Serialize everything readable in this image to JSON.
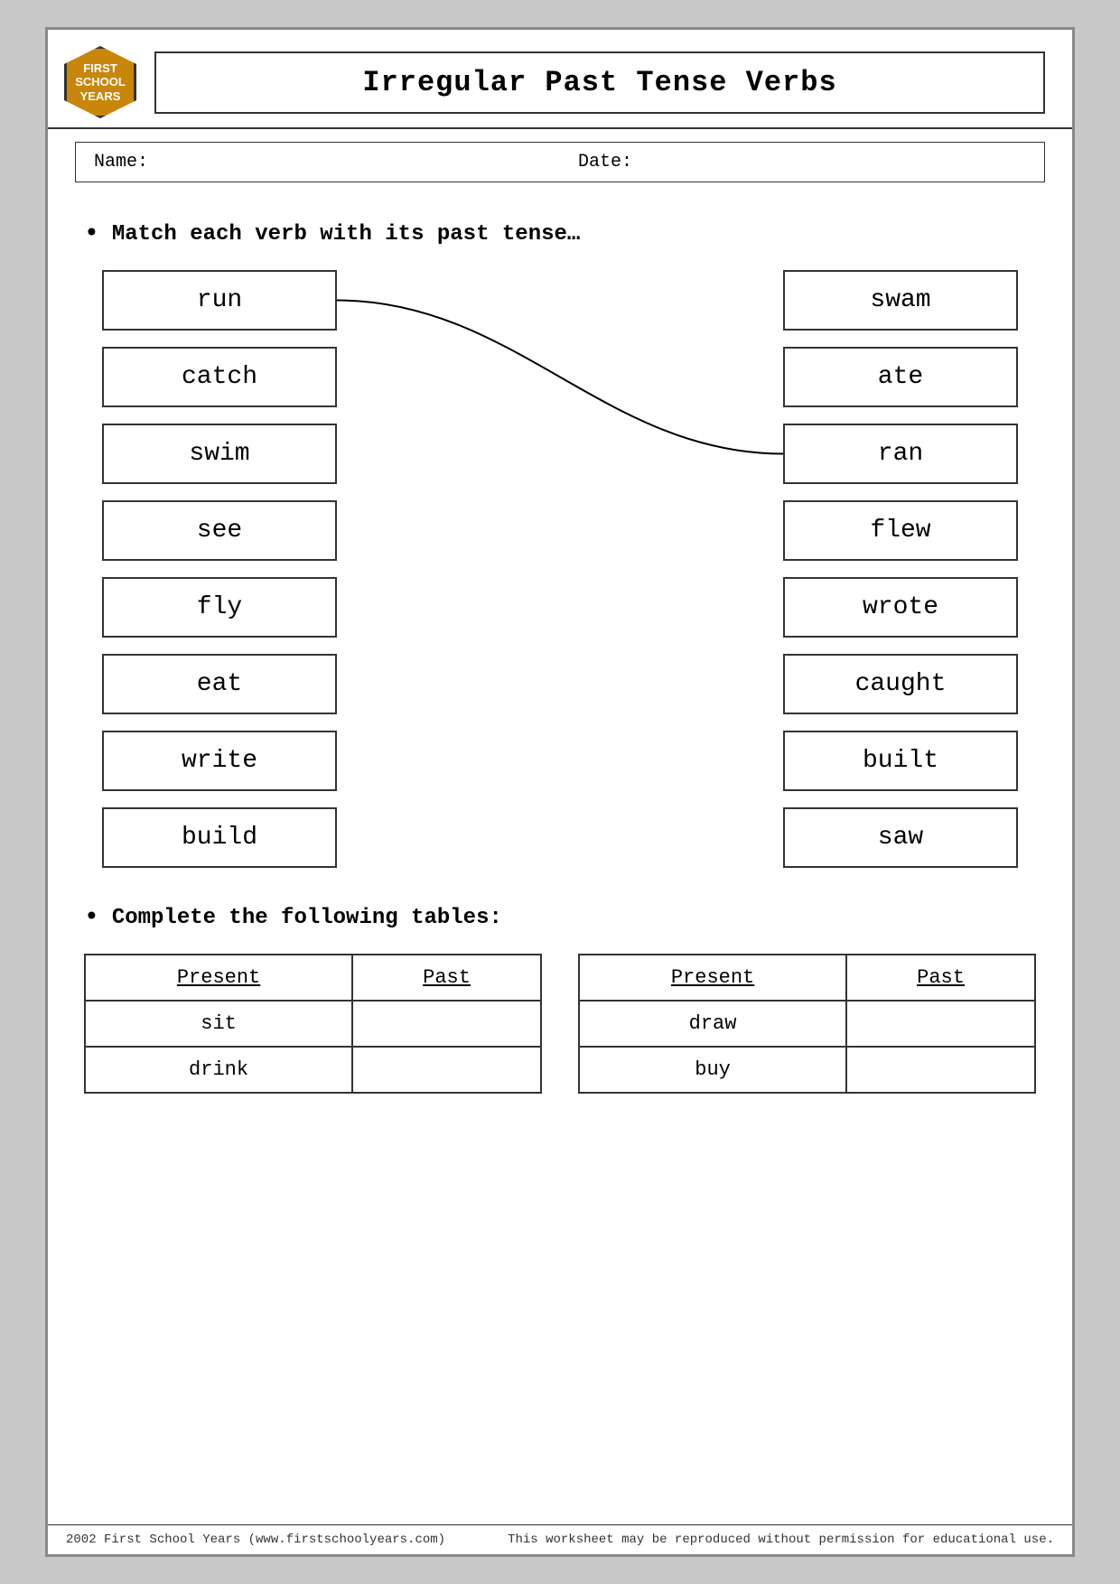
{
  "header": {
    "logo_line1": "FIRST",
    "logo_line2": "SCHOOL",
    "logo_line3": "YEARS",
    "title": "Irregular Past Tense Verbs"
  },
  "fields": {
    "name_label": "Name:",
    "date_label": "Date:"
  },
  "instruction1": "Match each verb with its past tense…",
  "left_verbs": [
    {
      "word": "run"
    },
    {
      "word": "catch"
    },
    {
      "word": "swim"
    },
    {
      "word": "see"
    },
    {
      "word": "fly"
    },
    {
      "word": "eat"
    },
    {
      "word": "write"
    },
    {
      "word": "build"
    }
  ],
  "right_verbs": [
    {
      "word": "swam"
    },
    {
      "word": "ate"
    },
    {
      "word": "ran"
    },
    {
      "word": "flew"
    },
    {
      "word": "wrote"
    },
    {
      "word": "caught"
    },
    {
      "word": "built"
    },
    {
      "word": "saw"
    }
  ],
  "instruction2": "Complete the following tables:",
  "table1": {
    "col1": "Present",
    "col2": "Past",
    "rows": [
      {
        "present": "sit",
        "past": ""
      },
      {
        "present": "drink",
        "past": ""
      }
    ]
  },
  "table2": {
    "col1": "Present",
    "col2": "Past",
    "rows": [
      {
        "present": "draw",
        "past": ""
      },
      {
        "present": "buy",
        "past": ""
      }
    ]
  },
  "footer": {
    "left": "2002 First School Years  (www.firstschoolyears.com)",
    "right": "This worksheet may be reproduced without permission for educational use."
  }
}
